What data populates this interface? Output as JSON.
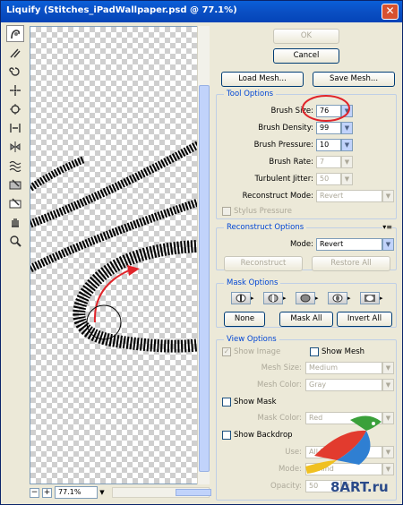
{
  "window": {
    "title": "Liquify (Stitches_iPadWallpaper.psd @ 77.1%)",
    "close_glyph": "✕"
  },
  "tools": [
    "forward-warp-icon",
    "reconstruct-brush-icon",
    "twirl-icon",
    "pucker-icon",
    "bloat-icon",
    "push-left-icon",
    "mirror-icon",
    "turbulence-icon",
    "freeze-mask-icon",
    "thaw-mask-icon",
    "hand-icon",
    "zoom-icon"
  ],
  "canvas": {
    "zoom": "77.1%",
    "zoom_out": "−",
    "zoom_in": "+",
    "zoom_arrow": "▼"
  },
  "buttons": {
    "ok": "OK",
    "cancel": "Cancel",
    "load_mesh": "Load Mesh...",
    "save_mesh": "Save Mesh..."
  },
  "tool_options": {
    "title": "Tool Options",
    "brush_size": {
      "label": "Brush Size:",
      "value": "76"
    },
    "brush_density": {
      "label": "Brush Density:",
      "value": "99"
    },
    "brush_pressure": {
      "label": "Brush Pressure:",
      "value": "10"
    },
    "brush_rate": {
      "label": "Brush Rate:",
      "value": "7"
    },
    "turbulent_jitter": {
      "label": "Turbulent Jitter:",
      "value": "50"
    },
    "reconstruct_mode": {
      "label": "Reconstruct Mode:",
      "value": "Revert"
    },
    "stylus_pressure": "Stylus Pressure"
  },
  "reconstruct_options": {
    "title": "Reconstruct Options",
    "menu_glyph": "▾≡",
    "mode_label": "Mode:",
    "mode_value": "Revert",
    "reconstruct": "Reconstruct",
    "restore_all": "Restore All"
  },
  "mask_options": {
    "title": "Mask Options",
    "none": "None",
    "mask_all": "Mask All",
    "invert_all": "Invert All"
  },
  "view_options": {
    "title": "View Options",
    "show_image": "Show Image",
    "show_mesh": "Show Mesh",
    "mesh_size": {
      "label": "Mesh Size:",
      "value": "Medium"
    },
    "mesh_color": {
      "label": "Mesh Color:",
      "value": "Gray"
    },
    "show_mask": "Show Mask",
    "mask_color": {
      "label": "Mask Color:",
      "value": "Red"
    },
    "show_backdrop": "Show Backdrop",
    "use": {
      "label": "Use:",
      "value": "All Layers"
    },
    "mode": {
      "label": "Mode:",
      "value": "Behind"
    },
    "opacity": {
      "label": "Opacity:",
      "value": "50"
    }
  },
  "watermark": "8ART.ru",
  "dd_glyph": "▼",
  "check_glyph": "✓",
  "colors": {
    "accent": "#0046d5",
    "highlight_circle": "#e0242a"
  }
}
